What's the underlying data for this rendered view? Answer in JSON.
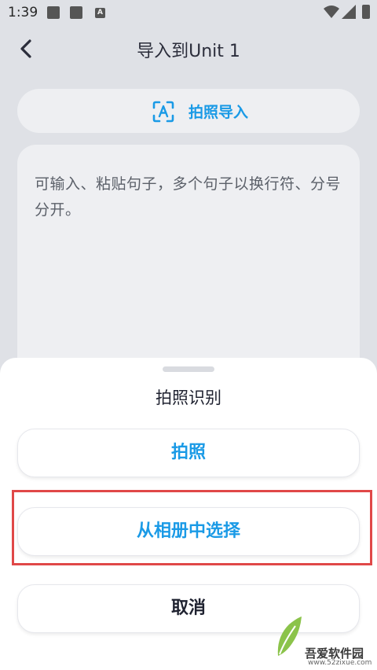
{
  "status_bar": {
    "time": "1:39",
    "keyboard_badge": "A"
  },
  "header": {
    "title": "导入到Unit 1"
  },
  "photo_import": {
    "label": "拍照导入",
    "icon": "scan-text-icon"
  },
  "input": {
    "placeholder": "可输入、粘贴句子，多个句子以换行符、分号分开。"
  },
  "sheet": {
    "title": "拍照识别",
    "options": [
      {
        "label": "拍照"
      },
      {
        "label": "从相册中选择"
      },
      {
        "label": "取消"
      }
    ]
  },
  "watermark": {
    "name": "吾爱软件园",
    "url": "www.52zixue.com"
  },
  "colors": {
    "accent": "#1a9ae6",
    "highlight": "#e04848",
    "dim_background": "#dfe1e6"
  }
}
